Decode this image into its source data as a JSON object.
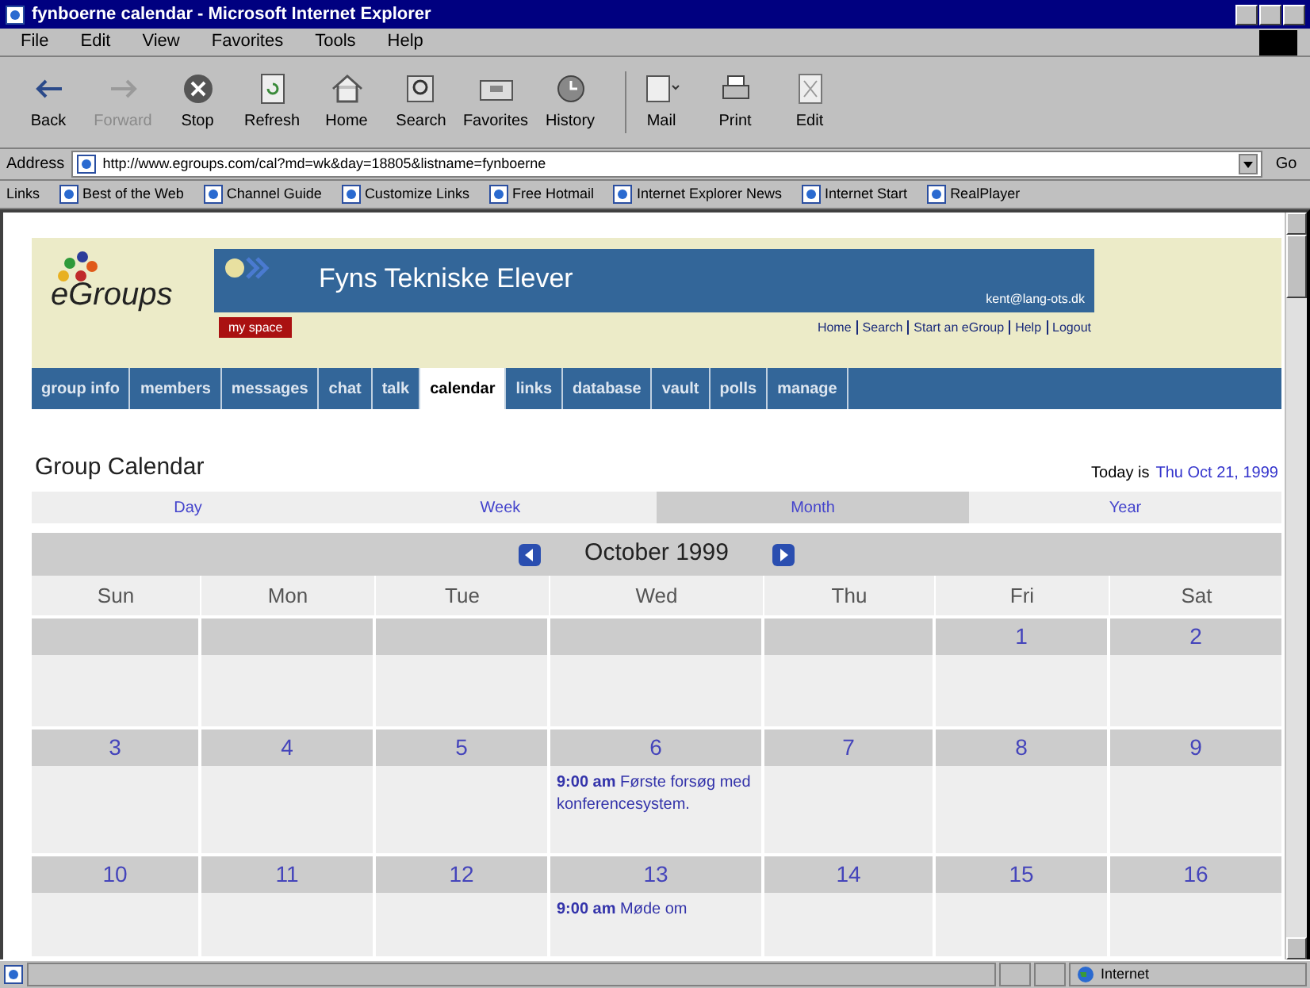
{
  "window": {
    "title": "fynboerne calendar - Microsoft Internet Explorer"
  },
  "menu": [
    "File",
    "Edit",
    "View",
    "Favorites",
    "Tools",
    "Help"
  ],
  "toolbar": [
    {
      "label": "Back",
      "kind": "back",
      "disabled": false
    },
    {
      "label": "Forward",
      "kind": "forward",
      "disabled": true
    },
    {
      "label": "Stop",
      "kind": "stop",
      "disabled": false
    },
    {
      "label": "Refresh",
      "kind": "refresh",
      "disabled": false
    },
    {
      "label": "Home",
      "kind": "home",
      "disabled": false
    },
    {
      "label": "Search",
      "kind": "search",
      "disabled": false
    },
    {
      "label": "Favorites",
      "kind": "favorites",
      "disabled": false
    },
    {
      "label": "History",
      "kind": "history",
      "disabled": false
    },
    {
      "label": "Mail",
      "kind": "mail",
      "disabled": false
    },
    {
      "label": "Print",
      "kind": "print",
      "disabled": false
    },
    {
      "label": "Edit",
      "kind": "edit",
      "disabled": false
    }
  ],
  "address": {
    "label": "Address",
    "value": "http://www.egroups.com/cal?md=wk&day=18805&listname=fynboerne",
    "go": "Go"
  },
  "links": {
    "label": "Links",
    "items": [
      "Best of the Web",
      "Channel Guide",
      "Customize Links",
      "Free Hotmail",
      "Internet Explorer News",
      "Internet Start",
      "RealPlayer"
    ]
  },
  "site": {
    "logo": "eGroups",
    "group_name": "Fyns Tekniske Elever",
    "email": "kent@lang-ots.dk",
    "my_space": "my space",
    "top_links": [
      "Home",
      "Search",
      "Start an eGroup",
      "Help",
      "Logout"
    ]
  },
  "tabs": [
    {
      "label": "group info",
      "selected": false
    },
    {
      "label": "members",
      "selected": false
    },
    {
      "label": "messages",
      "selected": false
    },
    {
      "label": "chat",
      "selected": false
    },
    {
      "label": "talk",
      "selected": false
    },
    {
      "label": "calendar",
      "selected": true
    },
    {
      "label": "links",
      "selected": false
    },
    {
      "label": "database",
      "selected": false
    },
    {
      "label": "vault",
      "selected": false
    },
    {
      "label": "polls",
      "selected": false
    },
    {
      "label": "manage",
      "selected": false
    }
  ],
  "calendar": {
    "title": "Group Calendar",
    "today_label": "Today is",
    "today": "Thu Oct 21, 1999",
    "views": [
      {
        "label": "Day",
        "selected": false
      },
      {
        "label": "Week",
        "selected": false
      },
      {
        "label": "Month",
        "selected": true
      },
      {
        "label": "Year",
        "selected": false
      }
    ],
    "month": "October 1999",
    "weekdays": [
      "Sun",
      "Mon",
      "Tue",
      "Wed",
      "Thu",
      "Fri",
      "Sat"
    ],
    "weeks": [
      [
        {
          "kind": "empty"
        },
        {
          "kind": "empty"
        },
        {
          "kind": "empty"
        },
        {
          "kind": "empty"
        },
        {
          "kind": "empty"
        },
        {
          "kind": "day",
          "date": "1"
        },
        {
          "kind": "day",
          "date": "2"
        }
      ],
      [
        {
          "date": "3"
        },
        {
          "date": "4"
        },
        {
          "date": "5"
        },
        {
          "date": "6",
          "events": [
            {
              "time": "9:00 am",
              "title": "Første forsøg med konferencesystem."
            }
          ]
        },
        {
          "date": "7"
        },
        {
          "date": "8"
        },
        {
          "date": "9"
        }
      ],
      [
        {
          "date": "10"
        },
        {
          "date": "11"
        },
        {
          "date": "12"
        },
        {
          "date": "13",
          "events": [
            {
              "time": "9:00 am",
              "title": "Møde om"
            }
          ]
        },
        {
          "date": "14"
        },
        {
          "date": "15"
        },
        {
          "date": "16"
        }
      ]
    ]
  },
  "status_bar": {
    "zone": "Internet"
  }
}
